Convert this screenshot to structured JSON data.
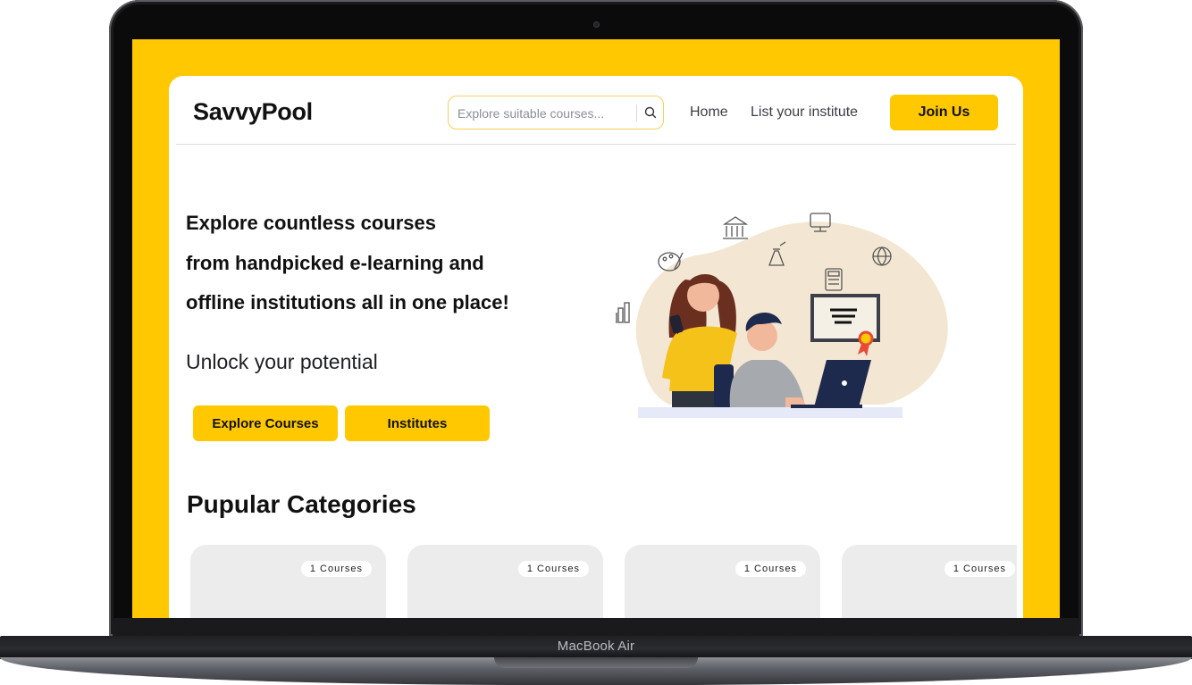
{
  "device": {
    "label": "MacBook Air"
  },
  "brand": {
    "name": "SavvyPool",
    "accent": "#FFC800"
  },
  "search": {
    "placeholder": "Explore suitable courses..."
  },
  "nav": {
    "home": "Home",
    "list_institute": "List your institute",
    "join": "Join Us"
  },
  "hero": {
    "lines": [
      "Explore countless courses",
      "from handpicked e-learning and",
      "offline institutions all in one place!"
    ],
    "subtitle": "Unlock your potential",
    "explore_button": "Explore Courses",
    "institutes_button": "Institutes"
  },
  "categories": {
    "title": "Pupular Categories",
    "items": [
      {
        "badge": "1 Courses"
      },
      {
        "badge": "1 Courses"
      },
      {
        "badge": "1 Courses"
      },
      {
        "badge": "1 Courses"
      }
    ]
  }
}
